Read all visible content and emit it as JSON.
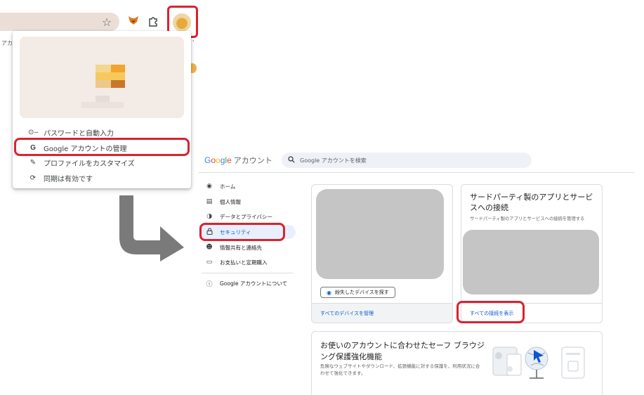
{
  "colors": {
    "highlight": "#d9232f",
    "link": "#0b57d0",
    "nav_active_bg": "#e8f0fe",
    "placeholder_gray": "#c5c5c5",
    "profile_card_bg": "#f2ebe6"
  },
  "browser": {
    "bookmark_fragment_left": "アカウ",
    "bookmark_fragment_right": "’",
    "icons": [
      "star-icon",
      "metamask-fox-icon",
      "puzzle-extension-icon",
      "profile-avatar"
    ]
  },
  "profile_menu": {
    "items": [
      {
        "icon": "key-icon",
        "glyph": "⊙─",
        "label": "パスワードと自動入力"
      },
      {
        "icon": "google-g-icon",
        "glyph": "G",
        "label": "Google アカウントの管理"
      },
      {
        "icon": "pencil-icon",
        "glyph": "✎",
        "label": "プロファイルをカスタマイズ"
      },
      {
        "icon": "sync-icon",
        "glyph": "⟳",
        "label": "同期は有効です"
      }
    ]
  },
  "account_page": {
    "logo": {
      "g1": "G",
      "o1": "o",
      "o2": "o",
      "g2": "g",
      "l": "l",
      "e": "e",
      "suffix": "アカウント"
    },
    "search_placeholder": "Google アカウントを検索",
    "nav": [
      {
        "icon": "home-icon",
        "glyph": "◉",
        "label": "ホーム"
      },
      {
        "icon": "personal-info-icon",
        "glyph": "▤",
        "label": "個人情報"
      },
      {
        "icon": "toggle-icon",
        "glyph": "◑",
        "label": "データとプライバシー"
      },
      {
        "icon": "lock-icon",
        "glyph": "⌂",
        "label": "セキュリティ"
      },
      {
        "icon": "people-icon",
        "glyph": "☻",
        "label": "情報共有と連絡先"
      },
      {
        "icon": "credit-card-icon",
        "glyph": "▭",
        "label": "お支払いと定期購入"
      },
      {
        "icon": "info-icon",
        "glyph": "ⓘ",
        "label": "Google アカウントについて"
      }
    ],
    "active_nav_index": 3,
    "devices_card": {
      "button_label": "紛失したデバイスを探す",
      "footer_link": "すべてのデバイスを管理"
    },
    "third_party_card": {
      "title": "サードパーティ製のアプリとサービスへの接続",
      "description": "サードパーティ製のアプリとサービスへの接続を管理する",
      "footer_link": "すべての接続を表示"
    },
    "safe_browsing_card": {
      "title": "お使いのアカウントに合わせたセーフ ブラウジング保護強化機能",
      "description": "危険なウェブサイトやダウンロード、拡張機能に対する保護を、利用状況に合わせて強化できます。"
    }
  }
}
